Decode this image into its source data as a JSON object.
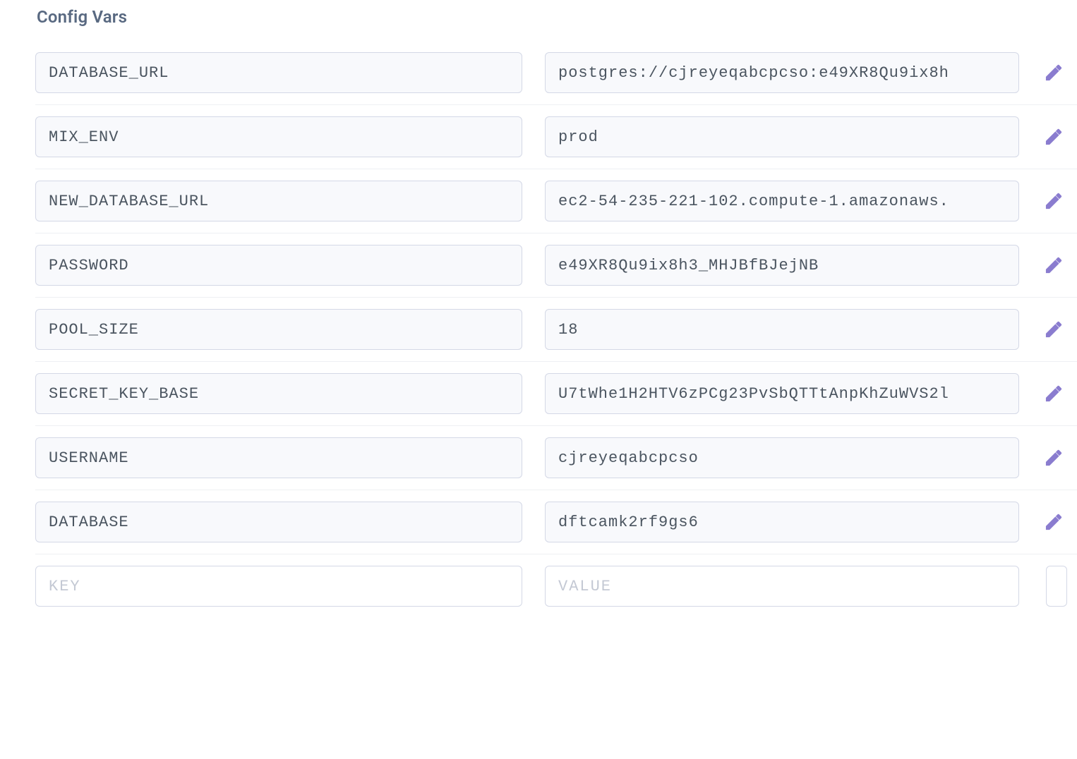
{
  "section": {
    "title": "Config Vars"
  },
  "vars": [
    {
      "key": "DATABASE_URL",
      "value": "postgres://cjreyeqabcpcso:e49XR8Qu9ix8h"
    },
    {
      "key": "MIX_ENV",
      "value": "prod"
    },
    {
      "key": "NEW_DATABASE_URL",
      "value": "ec2-54-235-221-102.compute-1.amazonaws."
    },
    {
      "key": "PASSWORD",
      "value": "e49XR8Qu9ix8h3_MHJBfBJejNB"
    },
    {
      "key": "POOL_SIZE",
      "value": "18"
    },
    {
      "key": "SECRET_KEY_BASE",
      "value": "U7tWhe1H2HTV6zPCg23PvSbQTTtAnpKhZuWVS2l"
    },
    {
      "key": "USERNAME",
      "value": "cjreyeqabcpcso"
    },
    {
      "key": "DATABASE",
      "value": "dftcamk2rf9gs6"
    }
  ],
  "new_row": {
    "key_placeholder": "KEY",
    "value_placeholder": "VALUE"
  },
  "icons": {
    "edit": "pencil-icon"
  },
  "colors": {
    "accent": "#8a7ccf",
    "title": "#596981",
    "field_bg": "#f8f9fc",
    "field_border": "#d4d8e6",
    "text": "#4b5560"
  }
}
